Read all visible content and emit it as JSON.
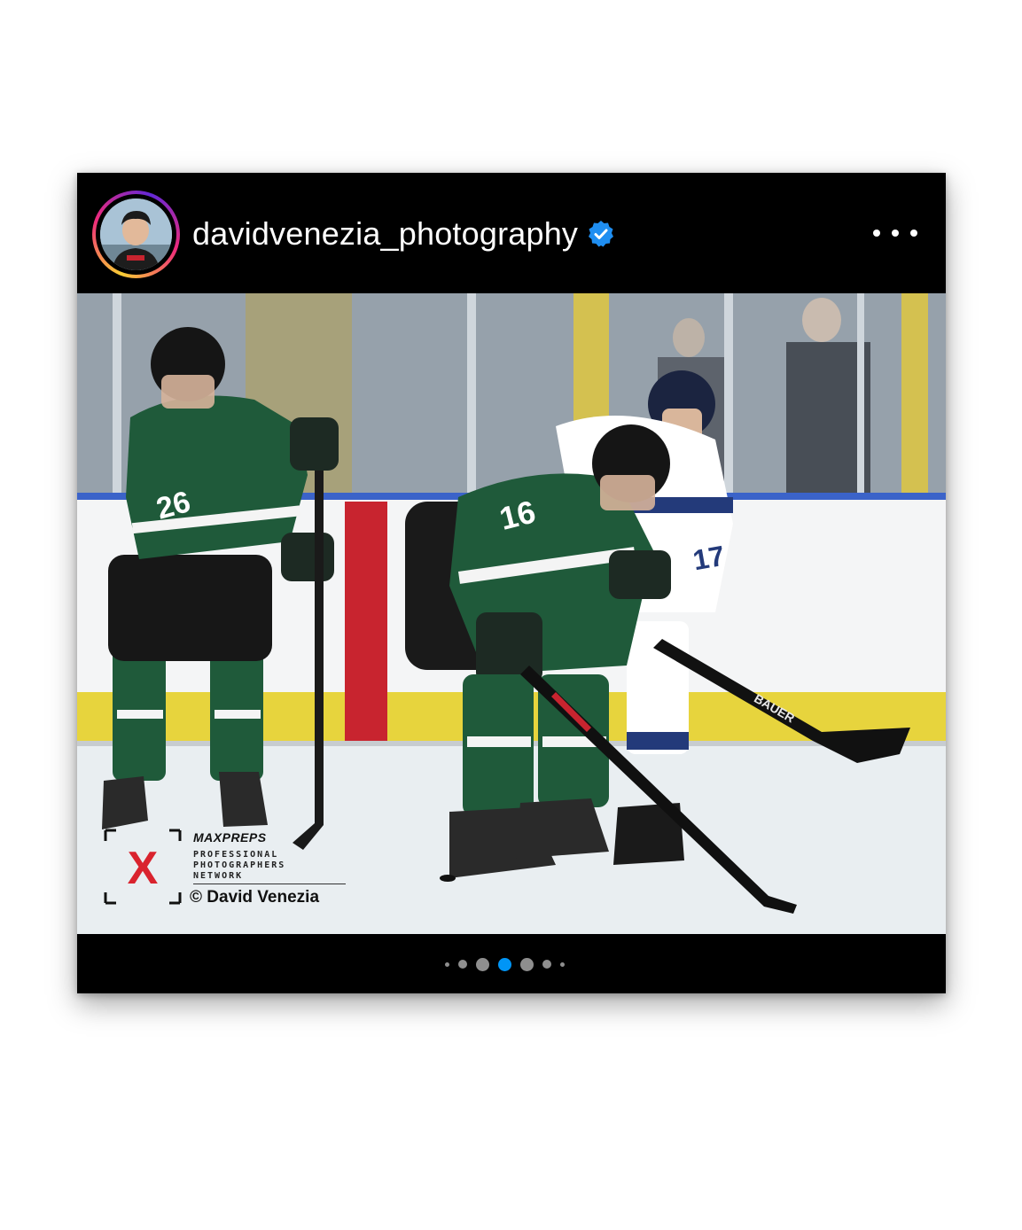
{
  "post": {
    "username": "davidvenezia_photography",
    "verified": true,
    "more_icon": "more-horizontal-icon",
    "verified_icon": "verified-badge-icon"
  },
  "photo": {
    "jerseys": {
      "player_left": "26",
      "player_center": "16",
      "player_right": "17"
    },
    "stick_brand": "BAUER",
    "watermark": {
      "brand": "MAXPREPS",
      "line1": "PROFESSIONAL",
      "line2": "PHOTOGRAPHERS",
      "line3": "NETWORK",
      "credit": "© David Venezia",
      "logo_letter": "X"
    }
  },
  "carousel": {
    "total_dots_visible": 7,
    "active_index": 3,
    "active_color": "#0095f6",
    "inactive_color": "#8e8e8e"
  },
  "colors": {
    "background": "#000000",
    "team_green": "#1f5a3a",
    "team_white_blue": "#233a7a",
    "board_yellow": "#e9d43a",
    "board_red": "#c8242f"
  }
}
